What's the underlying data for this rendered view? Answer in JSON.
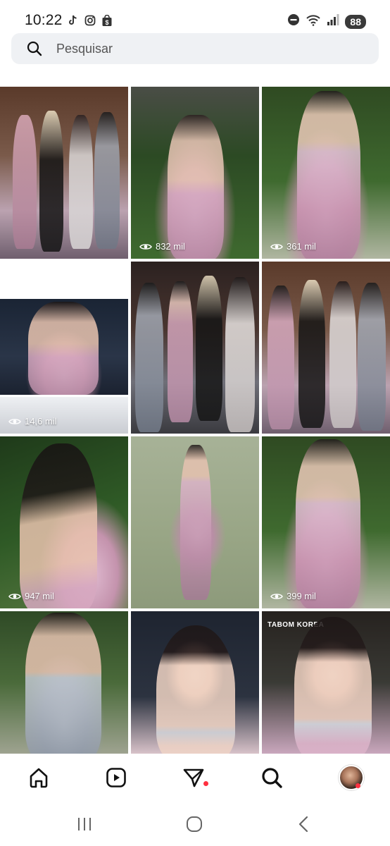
{
  "status_bar": {
    "time": "10:22",
    "left_icons": [
      "tiktok-icon",
      "instagram-icon",
      "shopping-bag-icon"
    ],
    "right_icons": [
      "do-not-disturb-icon",
      "wifi-icon",
      "signal-icon"
    ],
    "battery": "88"
  },
  "search": {
    "placeholder": "Pesquisar"
  },
  "grid": {
    "tiles": [
      {
        "views": ""
      },
      {
        "views": "832 mil"
      },
      {
        "views": "361 mil"
      },
      {
        "views": "14,6 mil"
      },
      {
        "views": ""
      },
      {
        "views": ""
      },
      {
        "views": "947 mil"
      },
      {
        "views": ""
      },
      {
        "views": "399 mil"
      },
      {
        "views": ""
      },
      {
        "views": ""
      },
      {
        "views": "",
        "watermark": "TABOM KOREA"
      }
    ]
  },
  "bottom_nav": {
    "items": [
      "home-icon",
      "reels-icon",
      "direct-icon",
      "explore-icon",
      "profile-avatar"
    ]
  },
  "system_nav": {
    "items": [
      "recents-icon",
      "home-circle-icon",
      "back-icon"
    ]
  },
  "colors": {
    "notification_dot": "#ff3040",
    "search_bg": "#eff1f4"
  }
}
